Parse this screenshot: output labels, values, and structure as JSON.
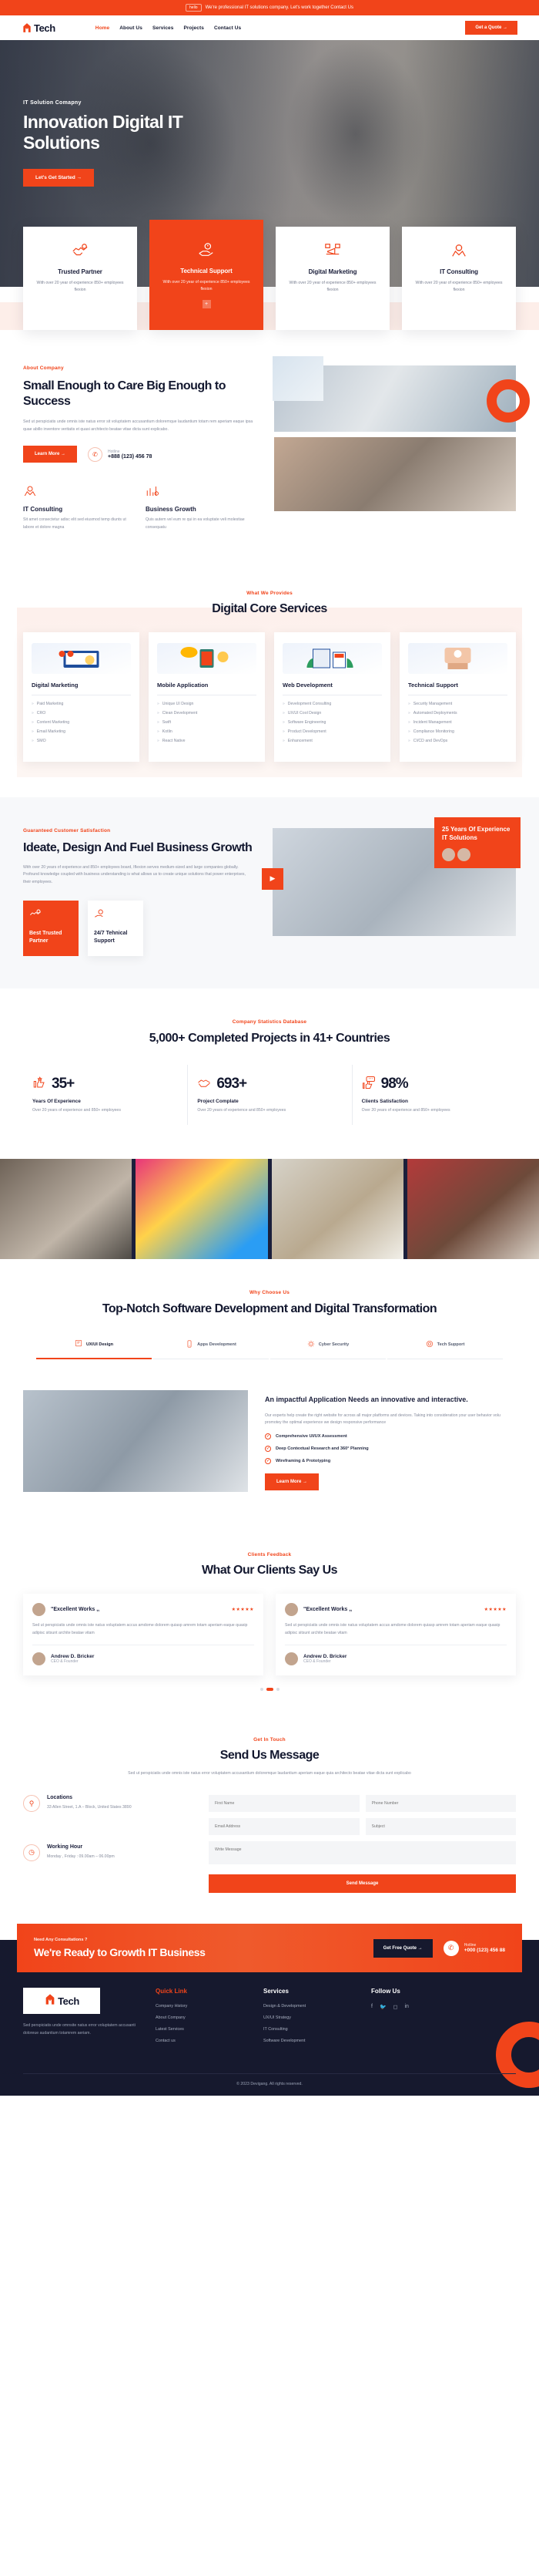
{
  "topbar": {
    "pill": "hello",
    "text": "We're professional IT solutions company. Let's work together Contact Us"
  },
  "nav": {
    "brand": "Tech",
    "links": [
      {
        "label": "Home",
        "active": true
      },
      {
        "label": "About Us",
        "active": false
      },
      {
        "label": "Services",
        "active": false
      },
      {
        "label": "Projects",
        "active": false
      },
      {
        "label": "Contact Us",
        "active": false
      }
    ],
    "cta": "Get a Quote  →"
  },
  "hero": {
    "eyebrow": "IT Solution Comapny",
    "title": "Innovation Digital IT Solutions",
    "button": "Let's Get Started  →"
  },
  "features": [
    {
      "icon": "handshake-icon",
      "title": "Trusted Partner",
      "text": "With over 20 year of experience 850+ employees flexion"
    },
    {
      "icon": "support-hand-icon",
      "title": "Technical Support",
      "text": "With over 20 year of experience 850+ employees flexion",
      "accent": true
    },
    {
      "icon": "megaphone-icon",
      "title": "Digital Marketing",
      "text": "With over 20 year of experience 850+ employees flexion"
    },
    {
      "icon": "gear-hands-icon",
      "title": "IT Consulting",
      "text": "With over 20 year of experience 850+ employees flexion"
    }
  ],
  "about": {
    "eyebrow": "About Company",
    "title": "Small Enough to Care Big Enough to Success",
    "text": "Sed ut perspiciatis unde omnis iste natus error sit voluptatem accusantium doloremque laudantium totam rem aperiam eaque ipsa quae abillo inventore veritatis et quasi architecto beatae vitae dicta sunt explicabo.",
    "button": "Learn More  →",
    "hotline_label": "Hotline",
    "hotline_number": "+888 (123) 456 78",
    "features": [
      {
        "icon": "gear-hands-icon",
        "title": "IT Consulting",
        "text": "Sit amet consectetur adisc elit sed eiusmod temp diunts ut labore et dolore magna"
      },
      {
        "icon": "growth-chart-icon",
        "title": "Business Growth",
        "text": "Quis autem vel eum re qui in ea voluptate veli molestiae consequatu"
      }
    ]
  },
  "services": {
    "eyebrow": "What We Provides",
    "title": "Digital Core Services",
    "cards": [
      {
        "title": "Digital Marketing",
        "items": [
          "Paid Marketing",
          "CRO",
          "Content Marketing",
          "Email Marketing",
          "SMO"
        ]
      },
      {
        "title": "Mobile Application",
        "items": [
          "Unique UI Design",
          "Clean Development",
          "Swift",
          "Kotlin",
          "React Native"
        ]
      },
      {
        "title": "Web Development",
        "items": [
          "Development Consulting",
          "UX/UI Cool Design",
          "Software Engineering",
          "Product Development",
          "Enhancement"
        ]
      },
      {
        "title": "Technical Support",
        "items": [
          "Security Management",
          "Automated Deployments",
          "Incident Management",
          "Compliance Monitoring",
          "CI/CD and DevOps"
        ]
      }
    ]
  },
  "ideate": {
    "eyebrow": "Guaranteed Customer Satisfaction",
    "title": "Ideate, Design And Fuel Business Growth",
    "text": "With over 20 years of experience and 850+ employees board, Iflexion serves medium-sized and large companies globally. Profound knowledge coupled with business understanding is what allows us to create unique solutions that power enterprises, their employees.",
    "minis": [
      {
        "icon": "handshake-icon",
        "title": "Best Trusted Partner",
        "accent": true
      },
      {
        "icon": "support-hand-icon",
        "title": "24/7 Tehnical Support",
        "accent": false
      }
    ],
    "badge_title": "25 Years Of Experience IT Solutions"
  },
  "stats": {
    "eyebrow": "Company Statistics Database",
    "title": "5,000+ Completed Projects in 41+ Countries",
    "items": [
      {
        "icon": "thumbs-up-star-icon",
        "number": "35+",
        "label": "Years Of Experience",
        "text": "Over 20 years of experience and 850+ employees"
      },
      {
        "icon": "handshake-icon",
        "number": "693+",
        "label": "Project Complate",
        "text": "Over 20 years of experience and 850+ employees"
      },
      {
        "icon": "rating-thumb-icon",
        "number": "98%",
        "label": "Clients Satisfaction",
        "text": "Over 20 years of experience and 850+ employees"
      }
    ]
  },
  "why": {
    "eyebrow": "Why Choose Us",
    "title": "Top-Notch Software Development and Digital Transformation",
    "tabs": [
      {
        "icon": "ux-design-icon",
        "label": "UX/UI Design",
        "active": true
      },
      {
        "icon": "apps-dev-icon",
        "label": "Apps Development",
        "active": false
      },
      {
        "icon": "cyber-security-icon",
        "label": "Cyber Security",
        "active": false
      },
      {
        "icon": "tech-support-icon",
        "label": "Tech Support",
        "active": false
      }
    ],
    "panel_title": "An impactful Application Needs an innovative and interactive.",
    "panel_text": "Our experts help create the right website for across all major platforms and devices. Taking into consideration your user behavior volu promotey the optimal experience we design responsive performance",
    "checks": [
      "Comprehensive UI/UX Assessment",
      "Deep Contextual Research and 360° Planning",
      "Wireframing & Prototyping"
    ],
    "button": "Learn More  →"
  },
  "testimonials": {
    "eyebrow": "Clients Feedback",
    "title": "What Our Clients Say Us",
    "cards": [
      {
        "quote": "\"Excellent Works ,,",
        "stars": "★★★★★",
        "text": "Sed ut perspiciatis unde omnis iste natus voluptatem accus amdome dolorem quiasp amrem totam aperiam eaque quasip adipisc sitsunt archite beatae vitam",
        "name": "Andrew D. Bricker",
        "role": "CEO & Founder"
      },
      {
        "quote": "\"Excellent Works ,,",
        "stars": "★★★★★",
        "text": "Sed ut perspiciatis unde omnis iste natus voluptatem accus amdome dolorem quiasp amrem totam aperiam eaque quasip adipisc sitsunt archite beatae vitam",
        "name": "Andrew D. Bricker",
        "role": "CEO & Founder"
      }
    ]
  },
  "contact": {
    "eyebrow": "Get In Touch",
    "title": "Send Us Message",
    "text": "Sed ut perspiciatis unde omnis iste natus error voluptatem accusantium doloremque laudantium aperiam eaque quia architecto beatae vitae dicta sunt explicabo",
    "info": [
      {
        "icon": "location-pin-icon",
        "title": "Locations",
        "text": "33 Allen Street, 1.A – Block, United States 3890"
      },
      {
        "icon": "clock-icon",
        "title": "Working Hour",
        "text": "Monday , Friday :  09.00am – 06.00pm"
      }
    ],
    "form": {
      "first_name": "First Name",
      "phone_number": "Phone Number",
      "email_address": "Email Address",
      "subject": "Subject",
      "message": "Write Message",
      "submit": "Send Message"
    }
  },
  "cta": {
    "sub": "Need Any Consultations ?",
    "title": "We're Ready to Growth IT Business",
    "button": "Get Free Quote  →",
    "hotline_label": "Hotline",
    "hotline_number": "+000 (123) 456 88"
  },
  "footer": {
    "brand": "Tech",
    "about": "Sed perspiciatis unde omnsite natus error voluptatem accusanti doloreue audantium totamrem aeriam.",
    "columns": [
      {
        "title_a": "Quick",
        "title_b": "Link",
        "links": [
          "Company History",
          "About Company",
          "Latest Services",
          "Contact us"
        ]
      },
      {
        "title_a": "Services",
        "title_b": "",
        "links": [
          "Design & Development",
          "UX/UI Strategy",
          "IT Consulting",
          "Software Development"
        ]
      }
    ],
    "follow_title": "Follow Us",
    "socials": [
      "facebook-icon",
      "twitter-icon",
      "instagram-icon",
      "linkedin-icon"
    ],
    "copyright": "© 2023 Devigang. All rights reserved."
  }
}
